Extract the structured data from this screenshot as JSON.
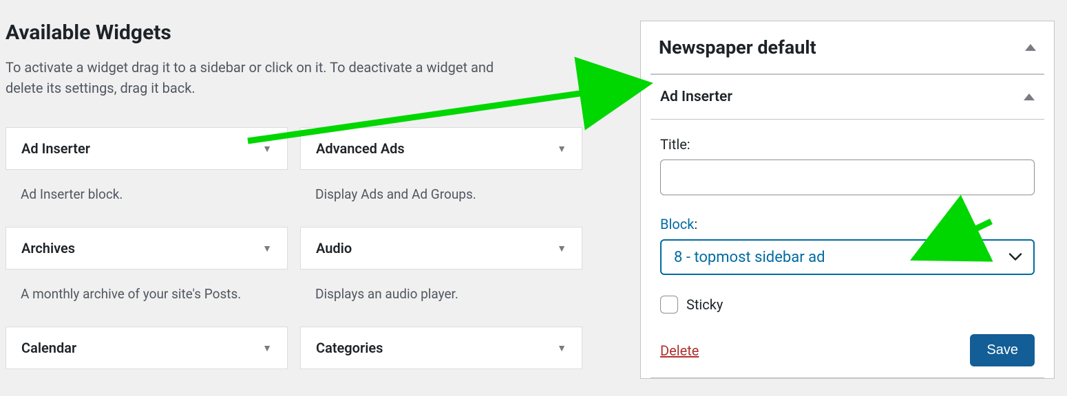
{
  "left": {
    "heading": "Available Widgets",
    "intro": "To activate a widget drag it to a sidebar or click on it. To deactivate a widget and delete its settings, drag it back.",
    "widgets": [
      {
        "title": "Ad Inserter",
        "desc": "Ad Inserter block."
      },
      {
        "title": "Advanced Ads",
        "desc": "Display Ads and Ad Groups."
      },
      {
        "title": "Archives",
        "desc": "A monthly archive of your site's Posts."
      },
      {
        "title": "Audio",
        "desc": "Displays an audio player."
      },
      {
        "title": "Calendar",
        "desc": ""
      },
      {
        "title": "Categories",
        "desc": ""
      }
    ]
  },
  "right": {
    "sidebar_title": "Newspaper default",
    "instance_title": "Ad Inserter",
    "title_label": "Title:",
    "title_value": "",
    "block_label": "Block",
    "block_colon": ":",
    "block_value": "8 - topmost sidebar ad",
    "sticky_label": "Sticky",
    "delete_label": "Delete",
    "save_label": "Save"
  }
}
